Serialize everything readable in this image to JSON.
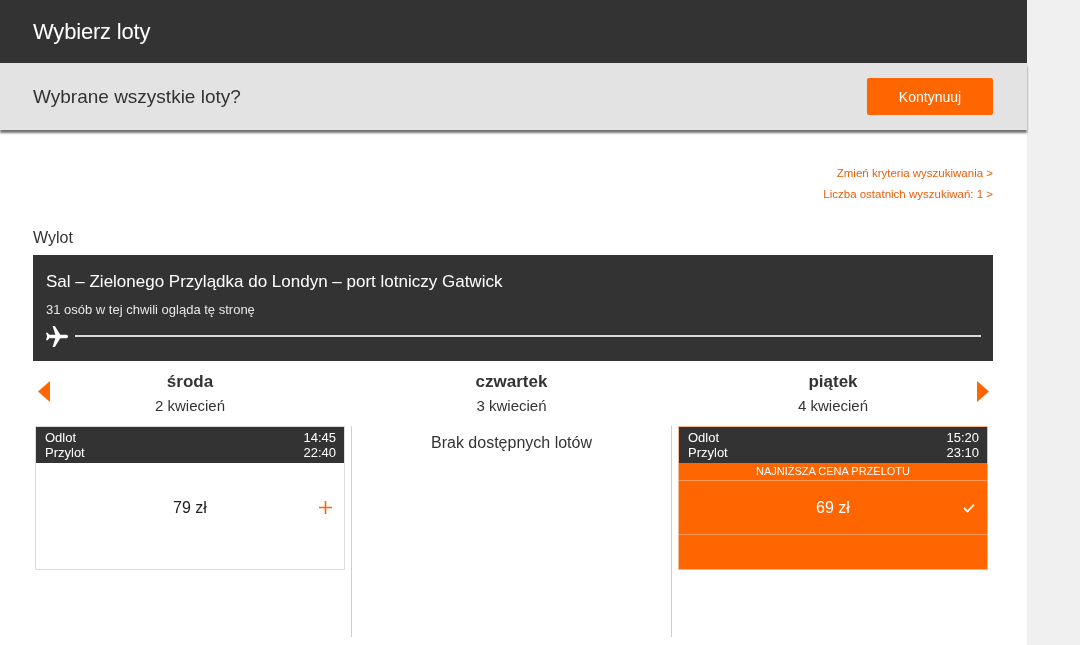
{
  "header": {
    "title": "Wybierz loty"
  },
  "confirm_bar": {
    "question": "Wybrane wszystkie loty?",
    "button": "Kontynuuj"
  },
  "links": [
    "Zmień kryteria wyszukiwania >",
    "Liczba ostatnich wyszukiwań: 1 >"
  ],
  "section_label": "Wylot",
  "route": {
    "title": "Sal – Zielonego Przylądka do Londyn – port lotniczy Gatwick",
    "viewers": "31 osób w tej chwili ogląda tę stronę"
  },
  "days": [
    {
      "weekday": "środa",
      "date": "2 kwiecień",
      "flights": [
        {
          "departure_label": "Odlot",
          "departure_time": "14:45",
          "arrival_label": "Przylot",
          "arrival_time": "22:40",
          "price": "79 zł",
          "selected": false
        }
      ]
    },
    {
      "weekday": "czwartek",
      "date": "3 kwiecień",
      "message": "Brak dostępnych lotów"
    },
    {
      "weekday": "piątek",
      "date": "4 kwiecień",
      "flights": [
        {
          "departure_label": "Odlot",
          "departure_time": "15:20",
          "arrival_label": "Przylot",
          "arrival_time": "23:10",
          "badge": "NAJNIŻSZA CENA PRZELOTU",
          "price": "69 zł",
          "selected": true
        }
      ]
    }
  ]
}
